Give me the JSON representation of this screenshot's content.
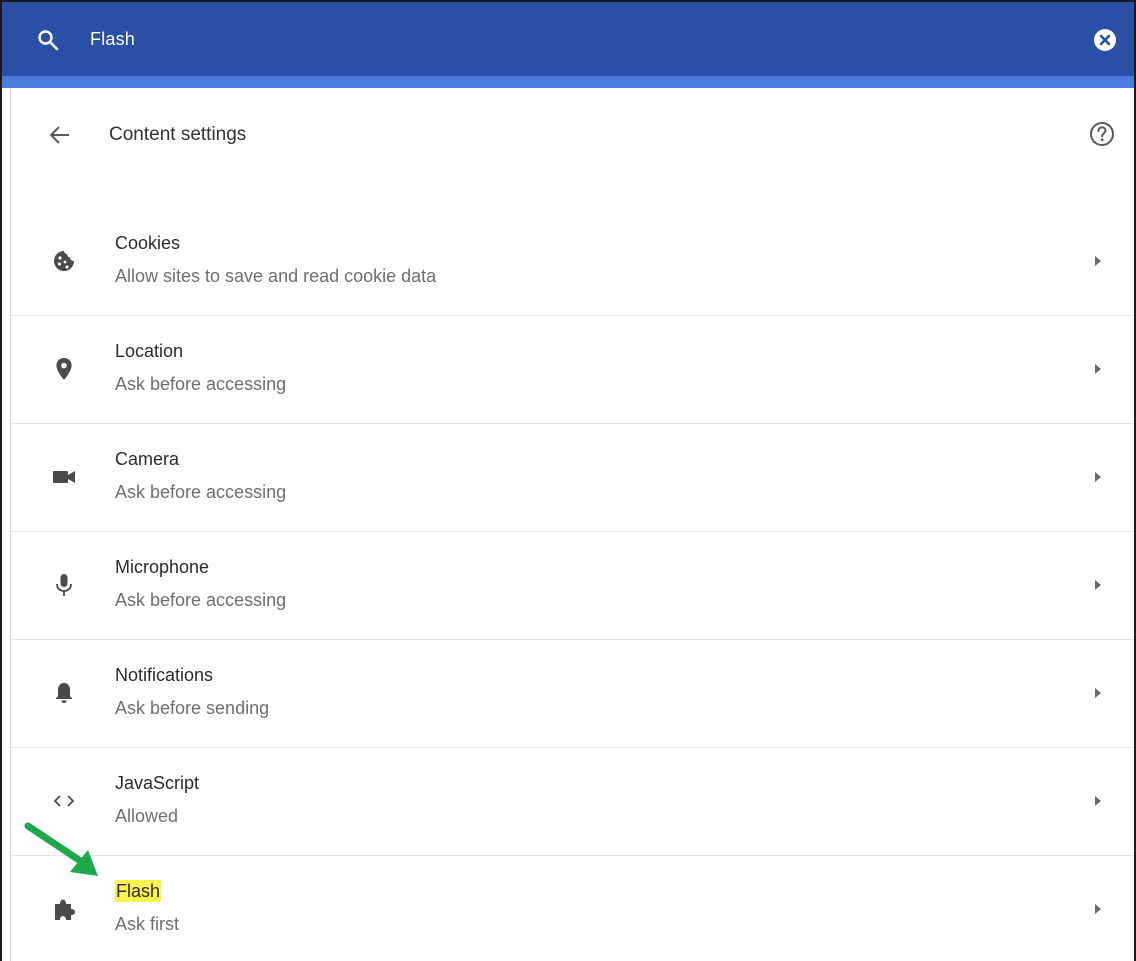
{
  "search": {
    "value": "Flash"
  },
  "header": {
    "title": "Content settings"
  },
  "settings": [
    {
      "label": "Cookies",
      "subtitle": "Allow sites to save and read cookie data",
      "icon": "cookie-icon"
    },
    {
      "label": "Location",
      "subtitle": "Ask before accessing",
      "icon": "location-pin-icon"
    },
    {
      "label": "Camera",
      "subtitle": "Ask before accessing",
      "icon": "camera-icon"
    },
    {
      "label": "Microphone",
      "subtitle": "Ask before accessing",
      "icon": "microphone-icon"
    },
    {
      "label": "Notifications",
      "subtitle": "Ask before sending",
      "icon": "bell-icon"
    },
    {
      "label": "JavaScript",
      "subtitle": "Allowed",
      "icon": "code-icon"
    },
    {
      "label": "Flash",
      "subtitle": "Ask first",
      "icon": "puzzle-icon",
      "highlighted": true
    }
  ],
  "colors": {
    "search_bar": "#2a4fa6",
    "search_accent": "#4a7ddf",
    "highlight": "#fdf24a",
    "arrow": "#1aaa4a"
  }
}
